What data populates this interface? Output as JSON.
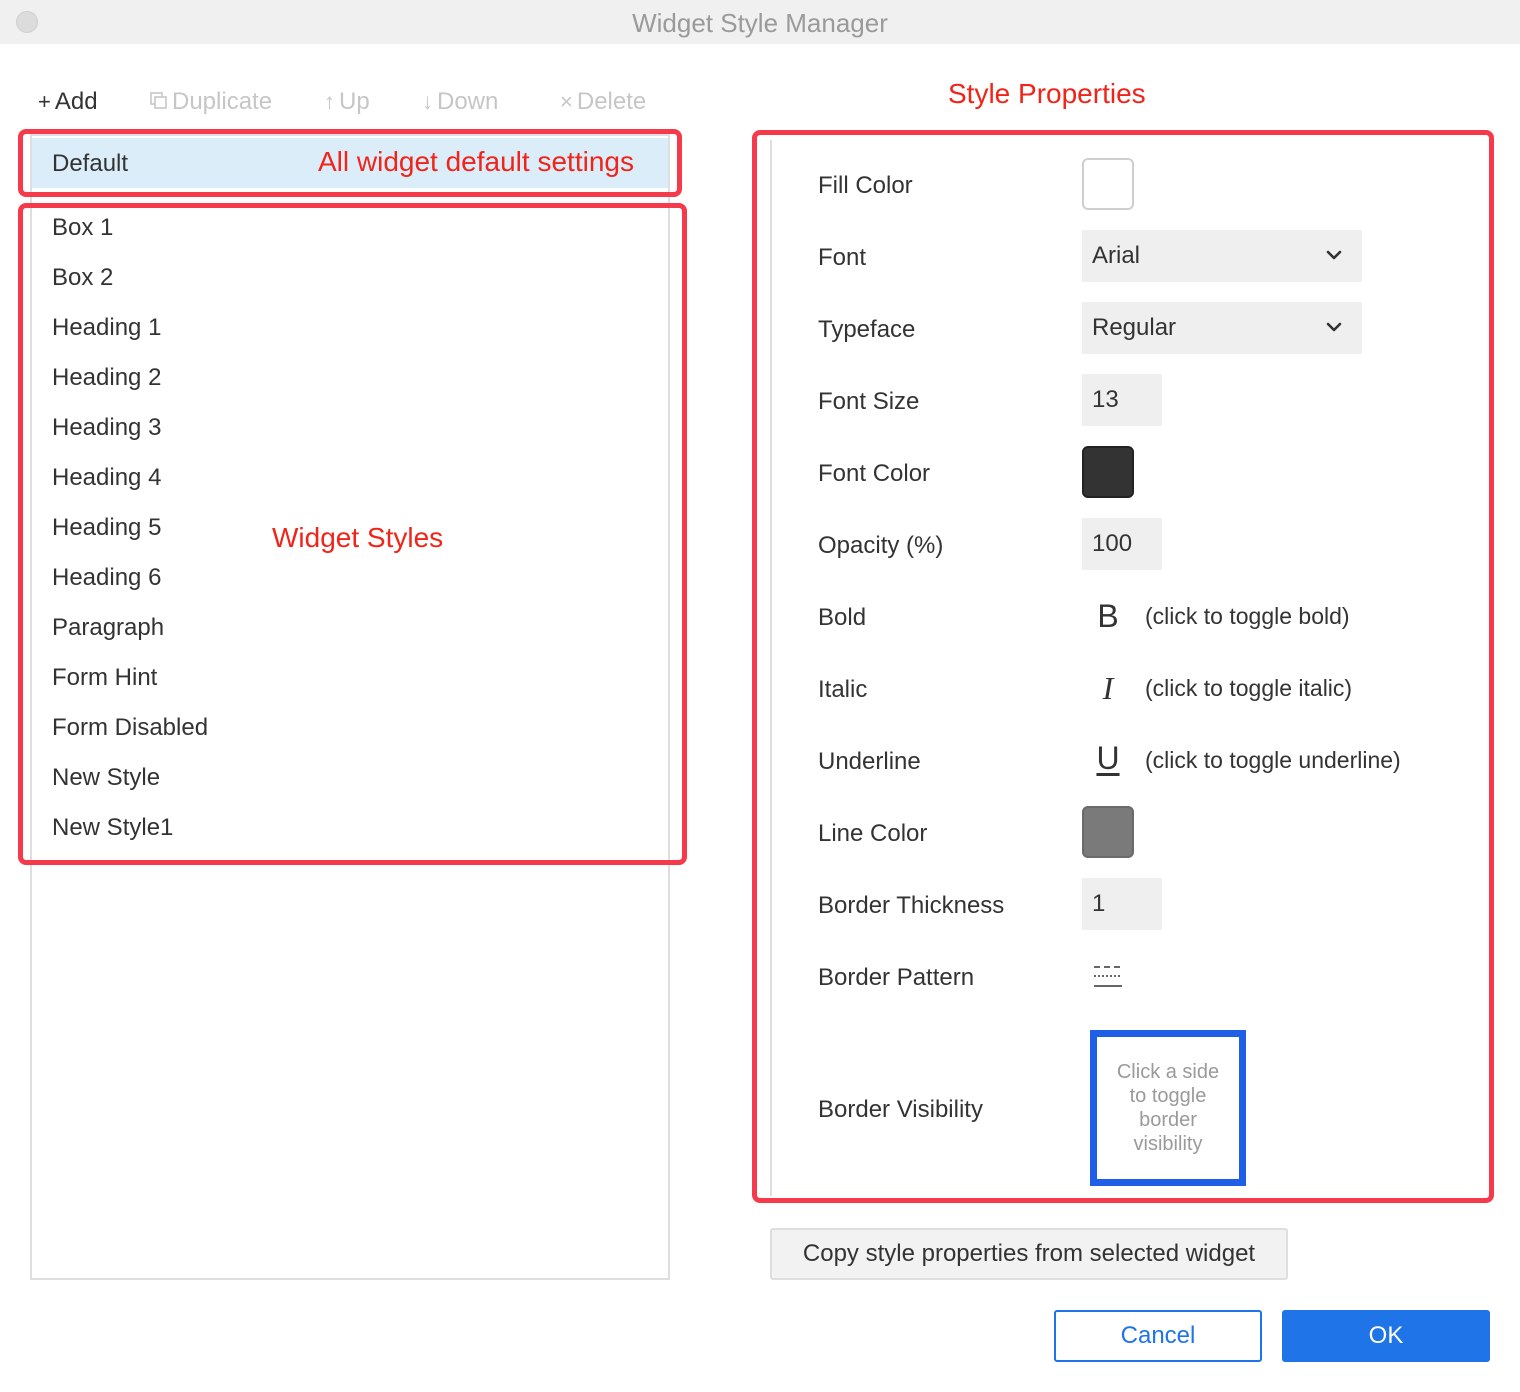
{
  "window": {
    "title": "Widget Style Manager"
  },
  "toolbar": {
    "add": "Add",
    "duplicate": "Duplicate",
    "up": "Up",
    "down": "Down",
    "delete": "Delete"
  },
  "styles": {
    "default_label": "Default",
    "items": [
      "Box 1",
      "Box 2",
      "Heading 1",
      "Heading 2",
      "Heading 3",
      "Heading 4",
      "Heading 5",
      "Heading 6",
      "Paragraph",
      "Form Hint",
      "Form Disabled",
      "New Style",
      "New Style1"
    ]
  },
  "annotations": {
    "default_note": "All widget default settings",
    "styles_note": "Widget Styles",
    "properties_note": "Style Properties"
  },
  "properties": {
    "fill_color": {
      "label": "Fill Color",
      "color": "#ffffff"
    },
    "font": {
      "label": "Font",
      "value": "Arial"
    },
    "typeface": {
      "label": "Typeface",
      "value": "Regular"
    },
    "font_size": {
      "label": "Font Size",
      "value": "13"
    },
    "font_color": {
      "label": "Font Color",
      "color": "#333333"
    },
    "opacity": {
      "label": "Opacity (%)",
      "value": "100"
    },
    "bold": {
      "label": "Bold",
      "glyph": "B",
      "hint": "(click to toggle bold)"
    },
    "italic": {
      "label": "Italic",
      "glyph": "I",
      "hint": "(click to toggle italic)"
    },
    "underline": {
      "label": "Underline",
      "glyph": "U",
      "hint": "(click to toggle underline)"
    },
    "line_color": {
      "label": "Line Color",
      "color": "#7a7a7a"
    },
    "border_thickness": {
      "label": "Border Thickness",
      "value": "1"
    },
    "border_pattern": {
      "label": "Border Pattern"
    },
    "border_visibility": {
      "label": "Border Visibility",
      "hint": "Click a side to toggle border visibility"
    }
  },
  "actions": {
    "copy": "Copy style properties from selected widget",
    "cancel": "Cancel",
    "ok": "OK"
  },
  "colors": {
    "accent": "#1f74e8",
    "annotation": "#f53a4c",
    "selection": "#dcedfa",
    "border_visibility_frame": "#1f5fe8"
  }
}
